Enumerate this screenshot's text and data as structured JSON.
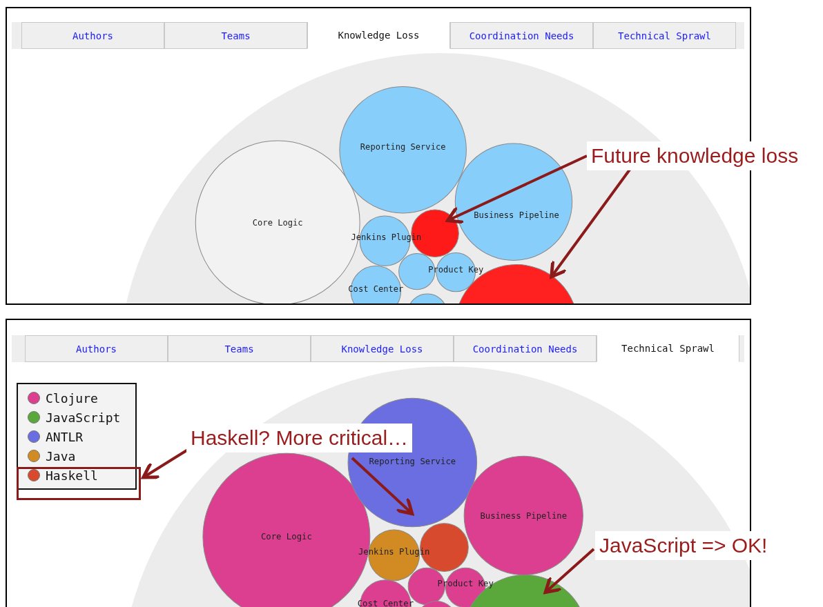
{
  "panels": [
    {
      "tabs": [
        {
          "label": "Authors",
          "selected": false
        },
        {
          "label": "Teams",
          "selected": false
        },
        {
          "label": "Knowledge Loss",
          "selected": true
        },
        {
          "label": "Coordination Needs",
          "selected": false
        },
        {
          "label": "Technical Sprawl",
          "selected": false
        }
      ],
      "bubbles": [
        {
          "label": "Core Logic",
          "color": "#f2f2f2"
        },
        {
          "label": "Reporting Service",
          "color": "#87cefa"
        },
        {
          "label": "Business Pipeline",
          "color": "#87cefa"
        },
        {
          "color": "#ff1a1a"
        },
        {
          "label": "Jenkins Plugin",
          "color": "#87cefa"
        },
        {
          "color": "#87cefa"
        },
        {
          "label": "Product Key",
          "color": "#87cefa"
        },
        {
          "label": "Cost Center",
          "color": "#87cefa"
        },
        {
          "color": "#87cefa"
        },
        {
          "color": "#ff2020"
        }
      ]
    },
    {
      "tabs": [
        {
          "label": "Authors",
          "selected": false
        },
        {
          "label": "Teams",
          "selected": false
        },
        {
          "label": "Knowledge Loss",
          "selected": false
        },
        {
          "label": "Coordination Needs",
          "selected": false
        },
        {
          "label": "Technical Sprawl",
          "selected": true
        }
      ],
      "legend": [
        {
          "label": "Clojure",
          "color": "#dc3f8f"
        },
        {
          "label": "JavaScript",
          "color": "#5aa83c"
        },
        {
          "label": "ANTLR",
          "color": "#6b6ee0"
        },
        {
          "label": "Java",
          "color": "#d18b22"
        },
        {
          "label": "Haskell",
          "color": "#d84a2e"
        }
      ],
      "bubbles": [
        {
          "label": "Core Logic",
          "color": "#dc3f8f"
        },
        {
          "label": "Reporting Service",
          "color": "#6b6ee0"
        },
        {
          "label": "Business Pipeline",
          "color": "#dc3f8f"
        },
        {
          "color": "#d84a2e"
        },
        {
          "label": "Jenkins Plugin",
          "color": "#d18b22"
        },
        {
          "color": "#dc3f8f"
        },
        {
          "label": "Product Key",
          "color": "#dc3f8f"
        },
        {
          "label": "Cost Center",
          "color": "#dc3f8f"
        },
        {
          "color": "#dc3f8f"
        },
        {
          "color": "#5aa83c"
        }
      ]
    }
  ],
  "annotations": [
    {
      "text": "Future knowledge loss"
    },
    {
      "text": "Haskell? More critical…"
    },
    {
      "text": "JavaScript => OK!"
    }
  ]
}
